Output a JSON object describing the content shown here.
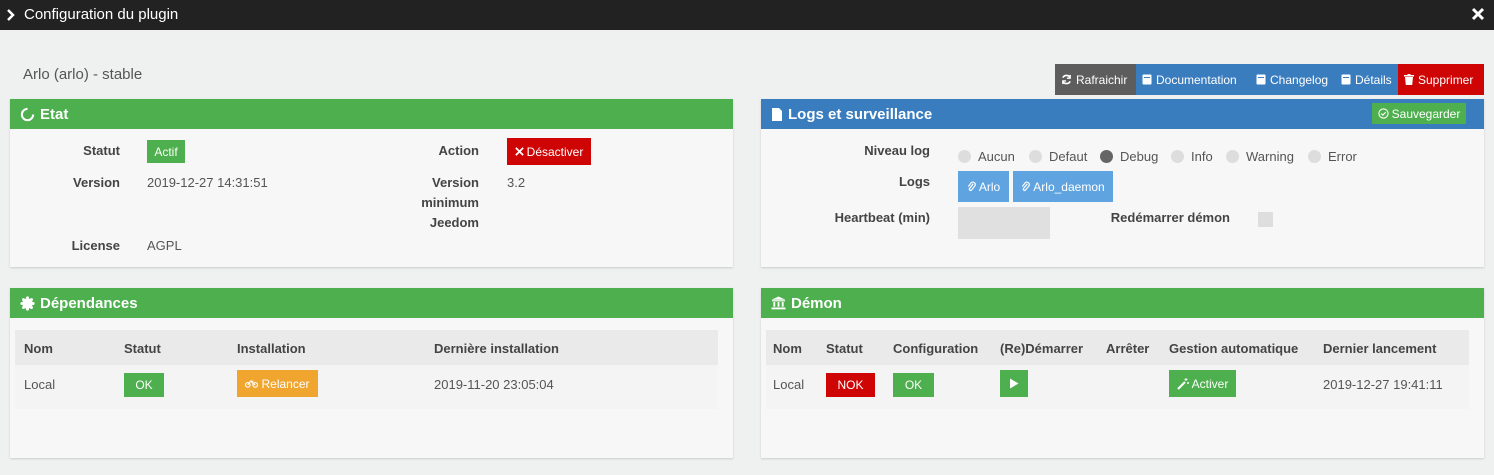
{
  "window": {
    "title": "Configuration du plugin",
    "close_icon": "close-icon",
    "chevron_icon": "chevron-right-icon"
  },
  "plugin": {
    "name": "Arlo (arlo) - stable"
  },
  "toolbar": {
    "refresh": "Rafraichir",
    "documentation": "Documentation",
    "changelog": "Changelog",
    "details": "Détails",
    "delete": "Supprimer"
  },
  "etat": {
    "title": "Etat",
    "statut_label": "Statut",
    "statut_value": "Actif",
    "version_label": "Version",
    "version_value": "2019-12-27 14:31:51",
    "license_label": "License",
    "license_value": "AGPL",
    "action_label": "Action",
    "action_button": "Désactiver",
    "minver_label_1": "Version",
    "minver_label_2": "minimum",
    "minver_label_3": "Jeedom",
    "minver_value": "3.2"
  },
  "logs": {
    "title": "Logs et surveillance",
    "save_button": "Sauvegarder",
    "level_label": "Niveau log",
    "levels": [
      "Aucun",
      "Defaut",
      "Debug",
      "Info",
      "Warning",
      "Error"
    ],
    "selected_level": "Debug",
    "logs_label": "Logs",
    "log_buttons": [
      "Arlo",
      "Arlo_daemon"
    ],
    "heartbeat_label": "Heartbeat (min)",
    "restart_label": "Redémarrer démon"
  },
  "deps": {
    "title": "Dépendances",
    "headers": [
      "Nom",
      "Statut",
      "Installation",
      "Dernière installation"
    ],
    "row": {
      "name": "Local",
      "status": "OK",
      "install_button": "Relancer",
      "last": "2019-11-20 23:05:04"
    }
  },
  "daemon": {
    "title": "Démon",
    "headers": [
      "Nom",
      "Statut",
      "Configuration",
      "(Re)Démarrer",
      "Arrêter",
      "Gestion automatique",
      "Dernier lancement"
    ],
    "row": {
      "name": "Local",
      "status": "NOK",
      "config": "OK",
      "auto_button": "Activer",
      "last": "2019-12-27 19:41:11"
    }
  },
  "colors": {
    "green": "#4daf4d",
    "blue": "#3a7dbf",
    "red": "#cf0505",
    "orange": "#f0a52f",
    "dark": "#222222"
  }
}
